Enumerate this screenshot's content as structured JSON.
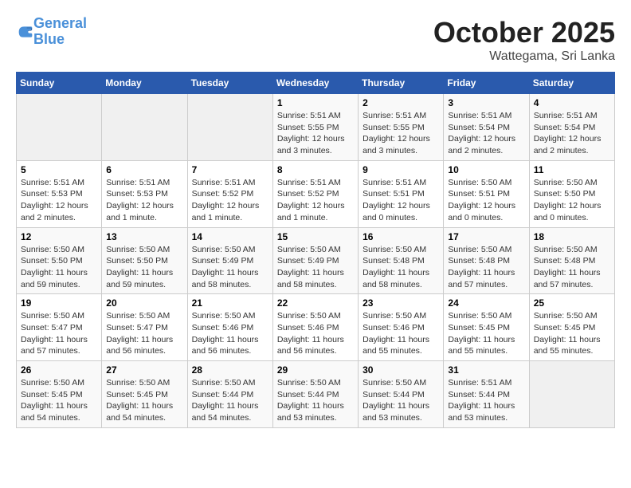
{
  "header": {
    "logo_line1": "General",
    "logo_line2": "Blue",
    "title": "October 2025",
    "subtitle": "Wattegama, Sri Lanka"
  },
  "days_of_week": [
    "Sunday",
    "Monday",
    "Tuesday",
    "Wednesday",
    "Thursday",
    "Friday",
    "Saturday"
  ],
  "weeks": [
    [
      {
        "day": "",
        "info": ""
      },
      {
        "day": "",
        "info": ""
      },
      {
        "day": "",
        "info": ""
      },
      {
        "day": "1",
        "info": "Sunrise: 5:51 AM\nSunset: 5:55 PM\nDaylight: 12 hours\nand 3 minutes."
      },
      {
        "day": "2",
        "info": "Sunrise: 5:51 AM\nSunset: 5:55 PM\nDaylight: 12 hours\nand 3 minutes."
      },
      {
        "day": "3",
        "info": "Sunrise: 5:51 AM\nSunset: 5:54 PM\nDaylight: 12 hours\nand 2 minutes."
      },
      {
        "day": "4",
        "info": "Sunrise: 5:51 AM\nSunset: 5:54 PM\nDaylight: 12 hours\nand 2 minutes."
      }
    ],
    [
      {
        "day": "5",
        "info": "Sunrise: 5:51 AM\nSunset: 5:53 PM\nDaylight: 12 hours\nand 2 minutes."
      },
      {
        "day": "6",
        "info": "Sunrise: 5:51 AM\nSunset: 5:53 PM\nDaylight: 12 hours\nand 1 minute."
      },
      {
        "day": "7",
        "info": "Sunrise: 5:51 AM\nSunset: 5:52 PM\nDaylight: 12 hours\nand 1 minute."
      },
      {
        "day": "8",
        "info": "Sunrise: 5:51 AM\nSunset: 5:52 PM\nDaylight: 12 hours\nand 1 minute."
      },
      {
        "day": "9",
        "info": "Sunrise: 5:51 AM\nSunset: 5:51 PM\nDaylight: 12 hours\nand 0 minutes."
      },
      {
        "day": "10",
        "info": "Sunrise: 5:50 AM\nSunset: 5:51 PM\nDaylight: 12 hours\nand 0 minutes."
      },
      {
        "day": "11",
        "info": "Sunrise: 5:50 AM\nSunset: 5:50 PM\nDaylight: 12 hours\nand 0 minutes."
      }
    ],
    [
      {
        "day": "12",
        "info": "Sunrise: 5:50 AM\nSunset: 5:50 PM\nDaylight: 11 hours\nand 59 minutes."
      },
      {
        "day": "13",
        "info": "Sunrise: 5:50 AM\nSunset: 5:50 PM\nDaylight: 11 hours\nand 59 minutes."
      },
      {
        "day": "14",
        "info": "Sunrise: 5:50 AM\nSunset: 5:49 PM\nDaylight: 11 hours\nand 58 minutes."
      },
      {
        "day": "15",
        "info": "Sunrise: 5:50 AM\nSunset: 5:49 PM\nDaylight: 11 hours\nand 58 minutes."
      },
      {
        "day": "16",
        "info": "Sunrise: 5:50 AM\nSunset: 5:48 PM\nDaylight: 11 hours\nand 58 minutes."
      },
      {
        "day": "17",
        "info": "Sunrise: 5:50 AM\nSunset: 5:48 PM\nDaylight: 11 hours\nand 57 minutes."
      },
      {
        "day": "18",
        "info": "Sunrise: 5:50 AM\nSunset: 5:48 PM\nDaylight: 11 hours\nand 57 minutes."
      }
    ],
    [
      {
        "day": "19",
        "info": "Sunrise: 5:50 AM\nSunset: 5:47 PM\nDaylight: 11 hours\nand 57 minutes."
      },
      {
        "day": "20",
        "info": "Sunrise: 5:50 AM\nSunset: 5:47 PM\nDaylight: 11 hours\nand 56 minutes."
      },
      {
        "day": "21",
        "info": "Sunrise: 5:50 AM\nSunset: 5:46 PM\nDaylight: 11 hours\nand 56 minutes."
      },
      {
        "day": "22",
        "info": "Sunrise: 5:50 AM\nSunset: 5:46 PM\nDaylight: 11 hours\nand 56 minutes."
      },
      {
        "day": "23",
        "info": "Sunrise: 5:50 AM\nSunset: 5:46 PM\nDaylight: 11 hours\nand 55 minutes."
      },
      {
        "day": "24",
        "info": "Sunrise: 5:50 AM\nSunset: 5:45 PM\nDaylight: 11 hours\nand 55 minutes."
      },
      {
        "day": "25",
        "info": "Sunrise: 5:50 AM\nSunset: 5:45 PM\nDaylight: 11 hours\nand 55 minutes."
      }
    ],
    [
      {
        "day": "26",
        "info": "Sunrise: 5:50 AM\nSunset: 5:45 PM\nDaylight: 11 hours\nand 54 minutes."
      },
      {
        "day": "27",
        "info": "Sunrise: 5:50 AM\nSunset: 5:45 PM\nDaylight: 11 hours\nand 54 minutes."
      },
      {
        "day": "28",
        "info": "Sunrise: 5:50 AM\nSunset: 5:44 PM\nDaylight: 11 hours\nand 54 minutes."
      },
      {
        "day": "29",
        "info": "Sunrise: 5:50 AM\nSunset: 5:44 PM\nDaylight: 11 hours\nand 53 minutes."
      },
      {
        "day": "30",
        "info": "Sunrise: 5:50 AM\nSunset: 5:44 PM\nDaylight: 11 hours\nand 53 minutes."
      },
      {
        "day": "31",
        "info": "Sunrise: 5:51 AM\nSunset: 5:44 PM\nDaylight: 11 hours\nand 53 minutes."
      },
      {
        "day": "",
        "info": ""
      }
    ]
  ]
}
